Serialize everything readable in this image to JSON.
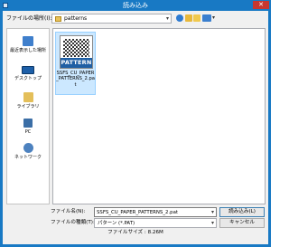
{
  "title": "読み込み",
  "close_glyph": "✕",
  "look_in": {
    "label": "ファイルの場所(I):",
    "value": "patterns"
  },
  "places": [
    {
      "label": "最近表示した場所",
      "icon": "recent-places-icon"
    },
    {
      "label": "デスクトップ",
      "icon": "desktop-icon"
    },
    {
      "label": "ライブラリ",
      "icon": "library-icon"
    },
    {
      "label": "PC",
      "icon": "pc-icon"
    },
    {
      "label": "ネットワーク",
      "icon": "network-icon"
    }
  ],
  "files": [
    {
      "thumb_text": "PATTERN",
      "name": "SSFS_CU_PAPER_PATTERNS_2.pat"
    }
  ],
  "filename": {
    "label": "ファイル名(N):",
    "value": "SSFS_CU_PAPER_PATTERNS_2.pat"
  },
  "filetype": {
    "label": "ファイルの種類(T):",
    "value": "パターン (*.PAT)"
  },
  "buttons": {
    "open": "読み込み(L)",
    "cancel": "キャンセル"
  },
  "filesize": "ファイルサイズ : 8.26M",
  "colors": {
    "titlebar": "#1879c4",
    "selection": "#cce8ff",
    "pattern_banner": "#1f5fa4"
  }
}
